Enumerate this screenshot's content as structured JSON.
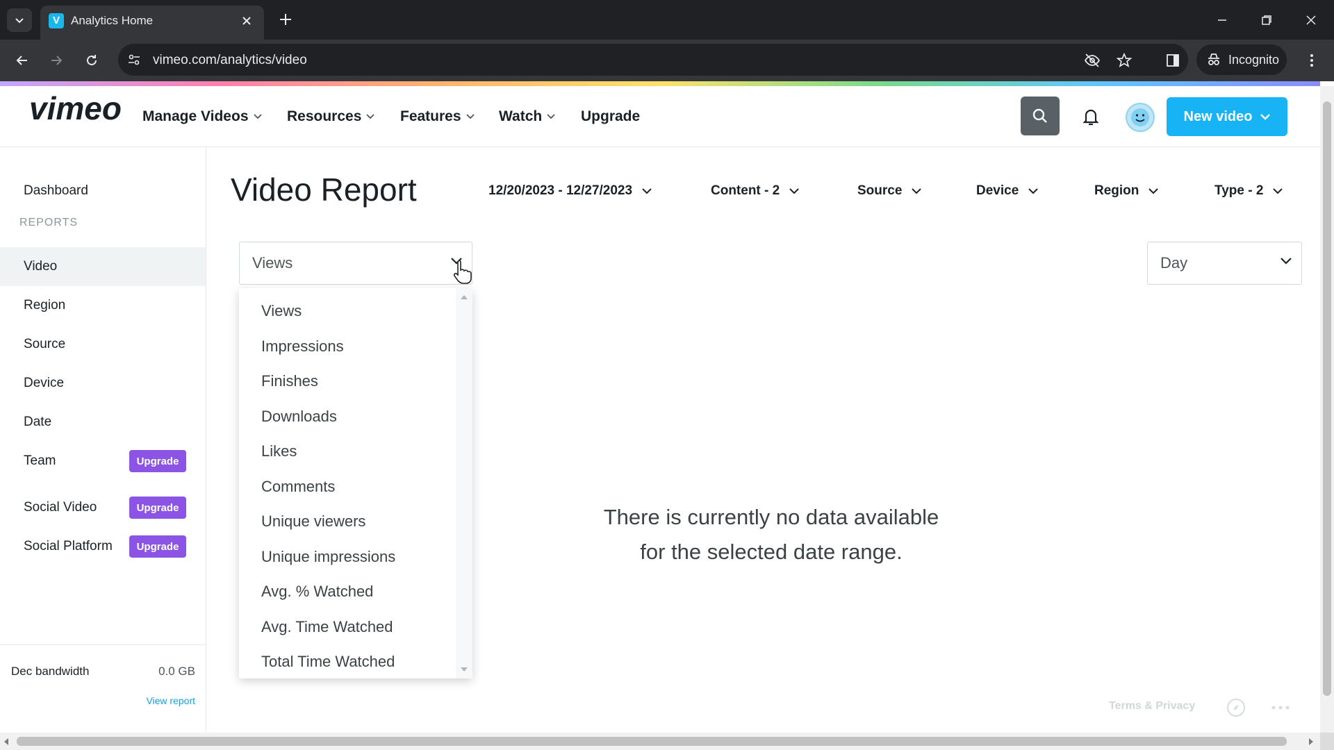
{
  "browser": {
    "tab_title": "Analytics Home",
    "tab_favicon": "V",
    "url": "vimeo.com/analytics/video",
    "incognito_label": "Incognito",
    "icons": [
      "tab-search-icon",
      "close-icon",
      "plus-icon",
      "minimize-icon",
      "restore-icon",
      "window-close-icon",
      "back-icon",
      "forward-icon",
      "reload-icon",
      "site-info-icon",
      "eye-off-icon",
      "star-icon",
      "side-panel-icon",
      "incognito-icon",
      "kebab-menu-icon"
    ]
  },
  "header": {
    "logo_text": "vimeo",
    "menu": [
      "Manage Videos",
      "Resources",
      "Features",
      "Watch"
    ],
    "upgrade_link": "Upgrade",
    "new_video_label": "New video",
    "brand_color": "#17b3f5"
  },
  "sidebar": {
    "dashboard": "Dashboard",
    "reports_heading": "REPORTS",
    "items": [
      "Video",
      "Region",
      "Source",
      "Device",
      "Date",
      "Team",
      "Social Video",
      "Social Platform"
    ],
    "active_item": "Video",
    "upgrade_badge": "Upgrade",
    "upgrade_color": "#8c54e4",
    "bandwidth_label": "Dec bandwidth",
    "bandwidth_value": "0.0 GB",
    "view_report": "View report"
  },
  "main": {
    "title": "Video Report",
    "filters": [
      "12/20/2023 - 12/27/2023",
      "Content - 2",
      "Source",
      "Device",
      "Region",
      "Type - 2"
    ],
    "metric_select": "Views",
    "interval_select": "Day",
    "metric_options": [
      "Views",
      "Impressions",
      "Finishes",
      "Downloads",
      "Likes",
      "Comments",
      "Unique viewers",
      "Unique impressions",
      "Avg. % Watched",
      "Avg. Time Watched",
      "Total Time Watched"
    ],
    "empty_line1": "There is currently no data available",
    "empty_line2": "for the selected date range.",
    "terms": "Terms & Privacy"
  }
}
